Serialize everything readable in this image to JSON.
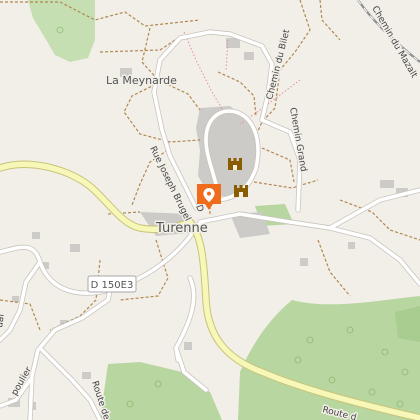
{
  "map": {
    "place_labels": {
      "turenne": "Turenne",
      "la_meynarde": "La Meynarde"
    },
    "street_labels": {
      "rue_joseph_brugel": "Rue Joseph Brugel",
      "chemin_du_bilet": "Chemin du Bilet",
      "chemin_grand": "Chemin Grand",
      "chemin_du_mazalt": "Chemin du Mazalt",
      "route_de_lim": "Route de Lim",
      "route_de": "Route d",
      "d_short": "D",
      "poulier": "poulier",
      "ual": "ual"
    },
    "road_shield": "D 150E3",
    "markers": [
      {
        "name": "selected-location-pin",
        "icon": "location-pin-icon",
        "color": "#ef6c1d"
      },
      {
        "name": "castle-poi-1",
        "icon": "castle-icon",
        "color": "#8a5c00"
      },
      {
        "name": "castle-poi-2",
        "icon": "castle-icon",
        "color": "#8a5c00"
      }
    ],
    "colors": {
      "background": "#f2efe9",
      "forest": "#b8d6a0",
      "major_road_fill": "#f7f7b8",
      "major_road_casing": "#c8c47a",
      "minor_road": "#ffffff",
      "track": "#b08850",
      "buildings": "#cdcbc7",
      "railway": "#8f8f8f"
    }
  }
}
